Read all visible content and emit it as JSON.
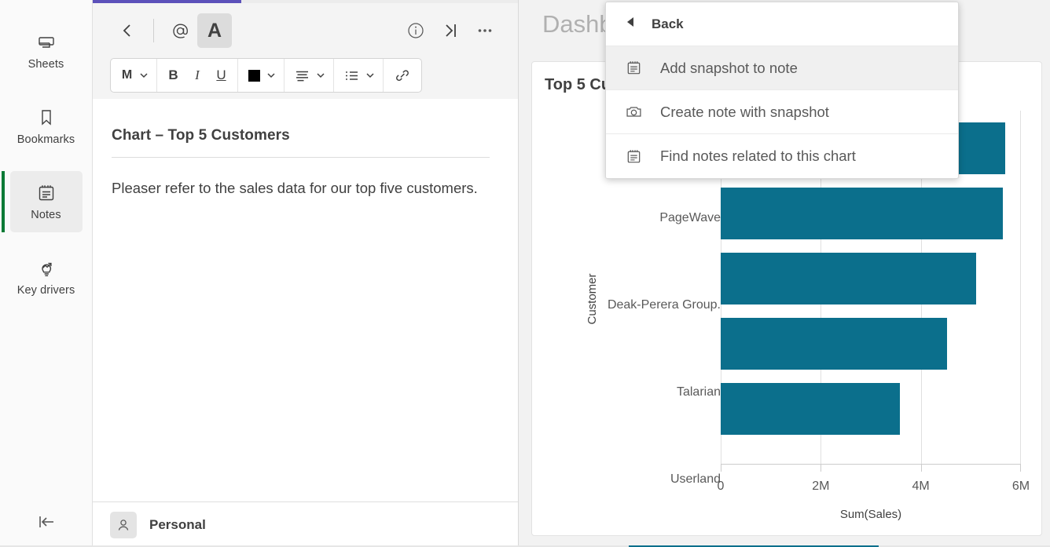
{
  "sidebar": {
    "items": [
      {
        "label": "Sheets",
        "icon": "sheets-icon",
        "selected": false
      },
      {
        "label": "Bookmarks",
        "icon": "bookmark-icon",
        "selected": false
      },
      {
        "label": "Notes",
        "icon": "notes-icon",
        "selected": true
      },
      {
        "label": "Key drivers",
        "icon": "key-drivers-icon",
        "selected": false
      }
    ],
    "collapse_icon": "collapse-left-icon"
  },
  "note_panel": {
    "toolbar": {
      "back_icon": "chevron-left-icon",
      "mention_icon": "at-mention-icon",
      "text_format_icon": "text-format-icon",
      "info_icon": "info-circle-icon",
      "collapse_icon": "collapse-right-icon",
      "more_icon": "more-options-icon"
    },
    "format_bar": {
      "style_label": "M",
      "bold_label": "B",
      "italic_label": "I",
      "underline_label": "U",
      "color_value": "#000000",
      "align_icon": "align-left-icon",
      "list_icon": "bullet-list-icon",
      "link_icon": "link-icon",
      "caret_icon": "chevron-down-icon"
    },
    "title": "Chart – Top 5 Customers",
    "body_text": "Pleaser refer to the sales data for our top five customers.",
    "footer": {
      "owner": "Personal",
      "avatar_icon": "user-icon"
    },
    "progress_percent": 35
  },
  "dashboard": {
    "title": "Dashboard",
    "chart_card_title": "Top 5 Customers"
  },
  "flyout_menu": {
    "back_label": "Back",
    "back_icon": "triangle-left-icon",
    "items": [
      {
        "label": "Add snapshot to note",
        "icon": "notes-icon",
        "hovered": true
      },
      {
        "label": "Create note with snapshot",
        "icon": "camera-icon",
        "hovered": false
      },
      {
        "label": "Find notes related to this chart",
        "icon": "notes-icon",
        "hovered": false
      }
    ]
  },
  "chart_data": {
    "type": "bar",
    "orientation": "horizontal",
    "title": "Top 5 Customers",
    "categories": [
      "",
      "PageWave",
      "Deak-Perera Group.",
      "Talarian",
      "Userland"
    ],
    "values": [
      5700000,
      5650000,
      5130000,
      4540000,
      3600000
    ],
    "series": [
      {
        "name": "Sum(Sales)",
        "values": [
          5700000,
          5650000,
          5130000,
          4540000,
          3600000
        ]
      }
    ],
    "xlabel": "Sum(Sales)",
    "ylabel": "Customer",
    "xlim": [
      0,
      6000000
    ],
    "xticks": [
      0,
      2000000,
      4000000,
      6000000
    ],
    "xtick_labels": [
      "0",
      "2M",
      "4M",
      "6M"
    ],
    "grid": true,
    "legend": false,
    "bar_color": "#0b6f8c"
  }
}
